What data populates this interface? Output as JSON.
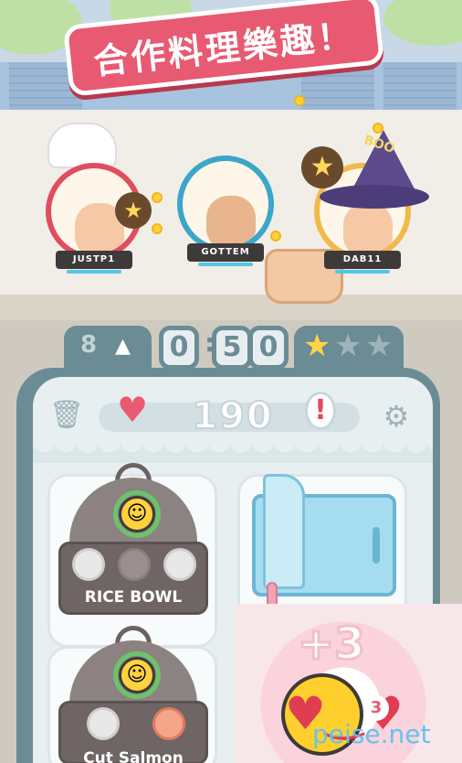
{
  "title": "合作料理樂趣！",
  "players": [
    {
      "name": "JUSTP1"
    },
    {
      "name": "GOTTEM"
    },
    {
      "name": "DAB11"
    }
  ],
  "wizard_hat_text": "BOO",
  "hud": {
    "level": "8",
    "timer": [
      "0",
      "5",
      "0"
    ],
    "stars_earned": 1,
    "stars_total": 3
  },
  "score": "190",
  "dishes": [
    {
      "label": "RICE BOWL"
    },
    {
      "label": "Cut Salmon"
    }
  ],
  "bonus": "+3",
  "combo": "3",
  "watermark": "peise.net",
  "colors": {
    "banner": "#e85a72",
    "panel": "#6b8c95",
    "heart": "#e85a72",
    "fridge": "#a5dcf0"
  },
  "icons": [
    "trash-icon",
    "gear-icon",
    "heart-icon",
    "alert-icon",
    "star-icon",
    "up-arrow-icon"
  ]
}
